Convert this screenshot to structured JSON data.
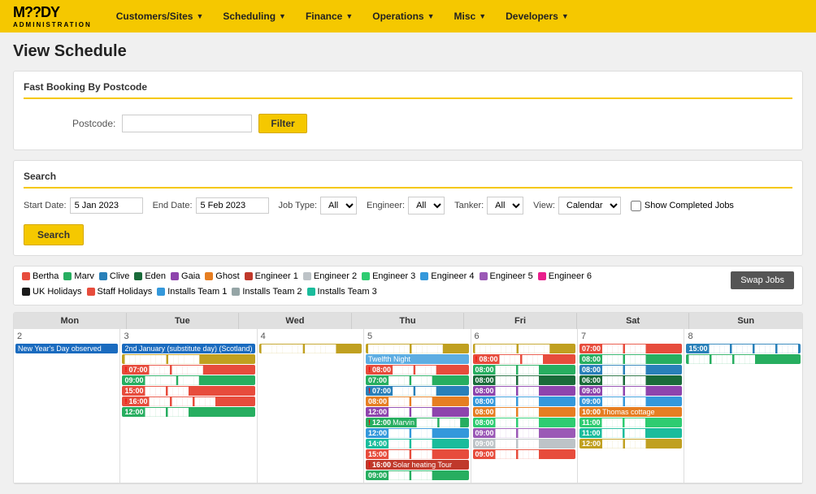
{
  "app": {
    "logo_main": "M??DY",
    "logo_sub": "ADMINISTRATION"
  },
  "nav": {
    "items": [
      {
        "label": "Customers/Sites",
        "id": "customers-sites"
      },
      {
        "label": "Scheduling",
        "id": "scheduling"
      },
      {
        "label": "Finance",
        "id": "finance"
      },
      {
        "label": "Operations",
        "id": "operations"
      },
      {
        "label": "Misc",
        "id": "misc"
      },
      {
        "label": "Developers",
        "id": "developers"
      }
    ]
  },
  "page": {
    "title": "View Schedule"
  },
  "fast_booking": {
    "title": "Fast Booking By Postcode",
    "postcode_label": "Postcode:",
    "postcode_value": "",
    "filter_btn": "Filter"
  },
  "search": {
    "title": "Search",
    "start_date_label": "Start Date:",
    "start_date_value": "5 Jan 2023",
    "end_date_label": "End Date:",
    "end_date_value": "5 Feb 2023",
    "job_type_label": "Job Type:",
    "job_type_value": "All",
    "engineer_label": "Engineer:",
    "engineer_value": "All",
    "tanker_label": "Tanker:",
    "tanker_value": "All",
    "view_label": "View:",
    "view_value": "Calendar",
    "show_completed_label": "Show Completed Jobs",
    "search_btn": "Search"
  },
  "legend": {
    "row1": [
      {
        "label": "Bertha",
        "color": "#e74c3c"
      },
      {
        "label": "Marv",
        "color": "#27ae60"
      },
      {
        "label": "Clive",
        "color": "#2980b9"
      },
      {
        "label": "Eden",
        "color": "#1a6b3a"
      },
      {
        "label": "Gaia",
        "color": "#8e44ad"
      },
      {
        "label": "Ghost",
        "color": "#e67e22"
      },
      {
        "label": "Engineer 1",
        "color": "#c0392b"
      },
      {
        "label": "Engineer 2",
        "color": "#bdc3c7"
      },
      {
        "label": "Engineer 3",
        "color": "#2ecc71"
      },
      {
        "label": "Engineer 4",
        "color": "#3498db"
      },
      {
        "label": "Engineer 5",
        "color": "#9b59b6"
      },
      {
        "label": "Engineer 6",
        "color": "#e91e8c"
      }
    ],
    "row2": [
      {
        "label": "UK Holidays",
        "color": "#1a1a1a"
      },
      {
        "label": "Staff Holidays",
        "color": "#e74c3c"
      },
      {
        "label": "Installs Team 1",
        "color": "#3498db"
      },
      {
        "label": "Installs Team 2",
        "color": "#95a5a6"
      },
      {
        "label": "Installs Team 3",
        "color": "#1abc9c"
      }
    ]
  },
  "swap_jobs_btn": "Swap Jobs",
  "calendar": {
    "headers": [
      "Mon",
      "Tue",
      "Wed",
      "Thu",
      "Fri",
      "Sat",
      "Sun"
    ],
    "days": [
      {
        "num": "2",
        "events": [
          {
            "text": "New Year's Day observed",
            "color": "#1a6bbf",
            "type": "holiday",
            "time": ""
          }
        ]
      },
      {
        "num": "3",
        "events": [
          {
            "text": "2nd January (substitute day) (Scotland)",
            "color": "#1a6bbf",
            "type": "holiday",
            "time": ""
          },
          {
            "text": "████████ ██████",
            "color": "#c0a020",
            "type": "event",
            "time": ""
          },
          {
            "text": "████ ██████",
            "color": "#e74c3c",
            "type": "event",
            "time": "07:00",
            "alert": true
          },
          {
            "text": "██████ ████",
            "color": "#27ae60",
            "type": "event",
            "time": "09:00",
            "alert": false
          },
          {
            "text": "████ ████",
            "color": "#e74c3c",
            "type": "event",
            "time": "15:00",
            "alert": false
          },
          {
            "text": "████ ████ ████",
            "color": "#e74c3c",
            "type": "event",
            "time": "16:00",
            "alert": true
          },
          {
            "text": "████ ████",
            "color": "#27ae60",
            "type": "event",
            "time": "12:00",
            "alert": false
          }
        ]
      },
      {
        "num": "4",
        "events": [
          {
            "text": "████████ ██████",
            "color": "#c0a020",
            "type": "event",
            "time": ""
          }
        ]
      },
      {
        "num": "5",
        "events": [
          {
            "text": "████████ ██████",
            "color": "#c0a020",
            "type": "event",
            "time": ""
          },
          {
            "text": "Twelfth Night",
            "color": "#5dade2",
            "type": "holiday",
            "time": ""
          },
          {
            "text": "████ ████",
            "color": "#e74c3c",
            "type": "event",
            "time": "08:00",
            "alert": true
          },
          {
            "text": "████ ████",
            "color": "#27ae60",
            "type": "event",
            "time": "07:00",
            "alert": false
          },
          {
            "text": "████ ████",
            "color": "#2980b9",
            "type": "event",
            "time": "07:00",
            "alert": true
          },
          {
            "text": "████ ████",
            "color": "#e67e22",
            "type": "event",
            "time": "08:00",
            "alert": false
          },
          {
            "text": "████ ████",
            "color": "#8e44ad",
            "type": "event",
            "time": "12:00",
            "alert": false
          },
          {
            "text": "Marvin ████ ████",
            "color": "#27ae60",
            "type": "event",
            "time": "12:00",
            "alert": true
          },
          {
            "text": "████ ████",
            "color": "#3498db",
            "type": "event",
            "time": "12:00",
            "alert": false
          },
          {
            "text": "████ ████",
            "color": "#1abc9c",
            "type": "event",
            "time": "14:00",
            "alert": false
          },
          {
            "text": "████ ████",
            "color": "#e74c3c",
            "type": "event",
            "time": "15:00",
            "alert": false
          },
          {
            "text": "Solar heating Tour",
            "color": "#c0392b",
            "type": "event",
            "time": "16:00",
            "alert": true
          },
          {
            "text": "████ ████",
            "color": "#27ae60",
            "type": "event",
            "time": "09:00",
            "alert": false
          }
        ]
      },
      {
        "num": "6",
        "events": [
          {
            "text": "████████ ██████",
            "color": "#c0a020",
            "type": "event",
            "time": ""
          },
          {
            "text": "████ ████",
            "color": "#e74c3c",
            "type": "event",
            "time": "08:00",
            "alert": true
          },
          {
            "text": "████ ████",
            "color": "#27ae60",
            "type": "event",
            "time": "08:00",
            "alert": false
          },
          {
            "text": "████ ████",
            "color": "#1a6b3a",
            "type": "event",
            "time": "08:00",
            "alert": false
          },
          {
            "text": "████ ████",
            "color": "#8e44ad",
            "type": "event",
            "time": "08:00",
            "alert": false
          },
          {
            "text": "████ ████",
            "color": "#3498db",
            "type": "event",
            "time": "08:00",
            "alert": false
          },
          {
            "text": "████ ████",
            "color": "#e67e22",
            "type": "event",
            "time": "08:00",
            "alert": false
          },
          {
            "text": "████ ████",
            "color": "#2ecc71",
            "type": "event",
            "time": "08:00",
            "alert": false
          },
          {
            "text": "████ ████",
            "color": "#9b59b6",
            "type": "event",
            "time": "09:00",
            "alert": false
          },
          {
            "text": "████ ████",
            "color": "#bdc3c7",
            "type": "event",
            "time": "09:00",
            "alert": false
          },
          {
            "text": "████ ████",
            "color": "#e74c3c",
            "type": "event",
            "time": "09:00",
            "alert": false
          }
        ]
      },
      {
        "num": "7",
        "events": [
          {
            "text": "████ ████",
            "color": "#e74c3c",
            "type": "event",
            "time": "07:00",
            "alert": false
          },
          {
            "text": "████ ████",
            "color": "#27ae60",
            "type": "event",
            "time": "08:00",
            "alert": false
          },
          {
            "text": "████ ████",
            "color": "#2980b9",
            "type": "event",
            "time": "08:00",
            "alert": false
          },
          {
            "text": "████ ████",
            "color": "#1a6b3a",
            "type": "event",
            "time": "06:00",
            "alert": false
          },
          {
            "text": "████ ████",
            "color": "#8e44ad",
            "type": "event",
            "time": "09:00",
            "alert": false
          },
          {
            "text": "████ ████",
            "color": "#3498db",
            "type": "event",
            "time": "09:00",
            "alert": false
          },
          {
            "text": "Thomas cottage",
            "color": "#e67e22",
            "type": "event",
            "time": "10:00",
            "alert": false
          },
          {
            "text": "████ ████",
            "color": "#2ecc71",
            "type": "event",
            "time": "11:00",
            "alert": false
          },
          {
            "text": "████ ████",
            "color": "#1abc9c",
            "type": "event",
            "time": "11:00",
            "alert": false
          },
          {
            "text": "████ ████",
            "color": "#c0a020",
            "type": "event",
            "time": "12:00",
            "alert": false
          }
        ]
      },
      {
        "num": "8",
        "events": [
          {
            "text": "████ ████ ████ ████",
            "color": "#2980b9",
            "type": "event",
            "time": "15:00",
            "alert": false
          },
          {
            "text": "████ ████ ████",
            "color": "#27ae60",
            "type": "event",
            "time": "",
            "alert": false
          }
        ]
      }
    ]
  }
}
